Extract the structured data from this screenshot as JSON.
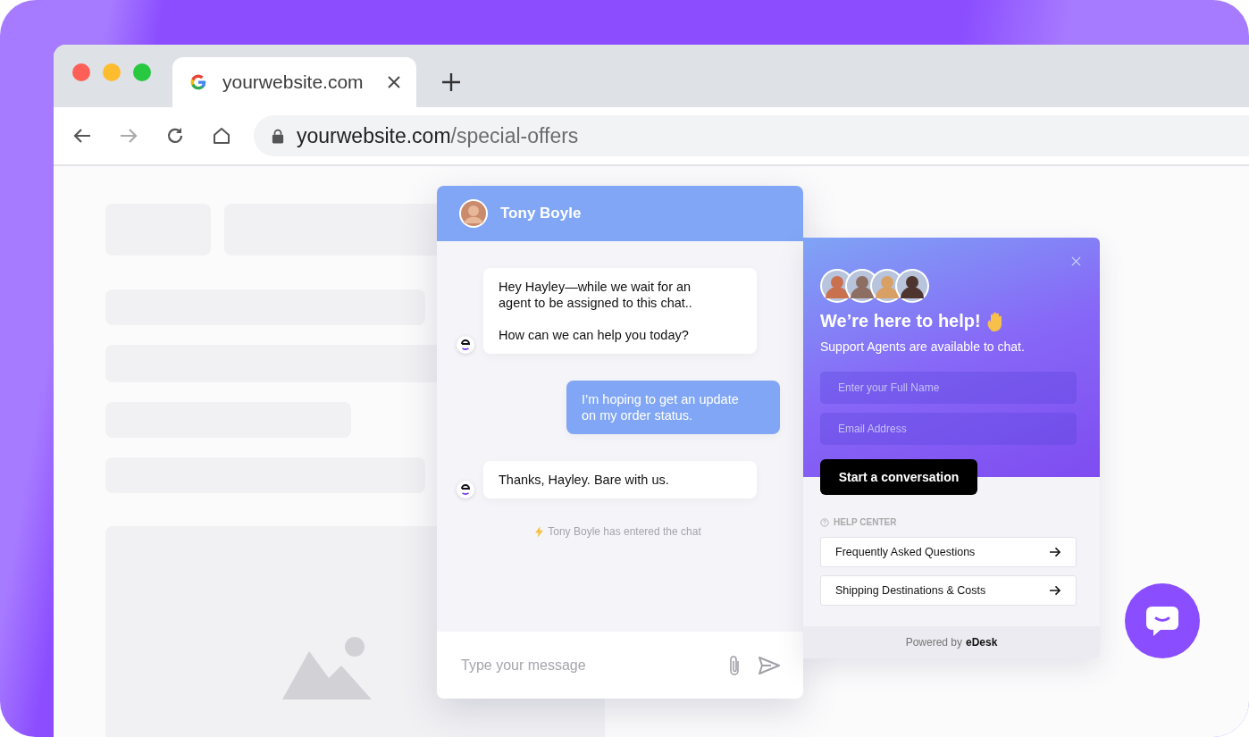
{
  "browser": {
    "tab": {
      "title": "yourwebsite.com",
      "selected": true
    },
    "url": {
      "host": "yourwebsite.com",
      "path": "/special-offers"
    }
  },
  "chat": {
    "agent_name": "Tony Boyle",
    "messages": [
      {
        "kind": "agent",
        "text": "Hey Hayley—while we wait for an\nagent to be assigned to this chat..\n\nHow can we can help you today?"
      },
      {
        "kind": "customer",
        "text": "I’m hoping to get an update\non my order status."
      },
      {
        "kind": "agent",
        "text": "Thanks, Hayley. Bare with us."
      },
      {
        "kind": "event",
        "text": "Tony Boyle has entered the chat"
      }
    ],
    "input": {
      "placeholder": "Type your message"
    }
  },
  "help_panel": {
    "title": "We’re here to help!",
    "subtitle": "Support Agents are available to chat.",
    "fields": [
      {
        "placeholder": "Enter your Full Name"
      },
      {
        "placeholder": "Email Address"
      }
    ],
    "button": "Start a conversation",
    "section": "HELP CENTER",
    "links": [
      "Frequently Asked Questions",
      "Shipping Destinations & Costs"
    ],
    "footer": {
      "text": "Powered by",
      "brand": "eDesk"
    }
  }
}
